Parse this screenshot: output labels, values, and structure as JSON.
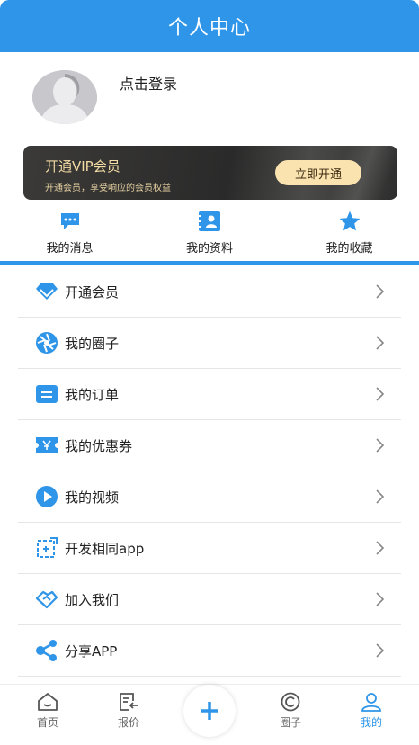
{
  "header": {
    "title": "个人中心"
  },
  "profile": {
    "login_text": "点击登录"
  },
  "vip": {
    "title": "开通VIP会员",
    "subtitle": "开通会员，享受响应的会员权益",
    "button": "立即开通"
  },
  "quick": [
    {
      "label": "我的消息",
      "icon": "message-icon"
    },
    {
      "label": "我的资料",
      "icon": "profile-card-icon"
    },
    {
      "label": "我的收藏",
      "icon": "star-icon"
    }
  ],
  "menu": [
    {
      "label": "开通会员",
      "icon": "diamond-icon"
    },
    {
      "label": "我的圈子",
      "icon": "aperture-icon"
    },
    {
      "label": "我的订单",
      "icon": "order-icon"
    },
    {
      "label": "我的优惠券",
      "icon": "coupon-icon"
    },
    {
      "label": "我的视频",
      "icon": "play-icon"
    },
    {
      "label": "开发相同app",
      "icon": "dev-icon"
    },
    {
      "label": "加入我们",
      "icon": "handshake-icon"
    },
    {
      "label": "分享APP",
      "icon": "share-icon"
    }
  ],
  "tabbar": {
    "items": [
      {
        "label": "首页",
        "icon": "home-icon"
      },
      {
        "label": "报价",
        "icon": "quote-icon"
      },
      {
        "label": "圈子",
        "icon": "circle-icon"
      },
      {
        "label": "我的",
        "icon": "user-icon"
      }
    ],
    "active": "我的"
  },
  "colors": {
    "accent": "#2f95e8",
    "vip_gold": "#f4dca5"
  }
}
